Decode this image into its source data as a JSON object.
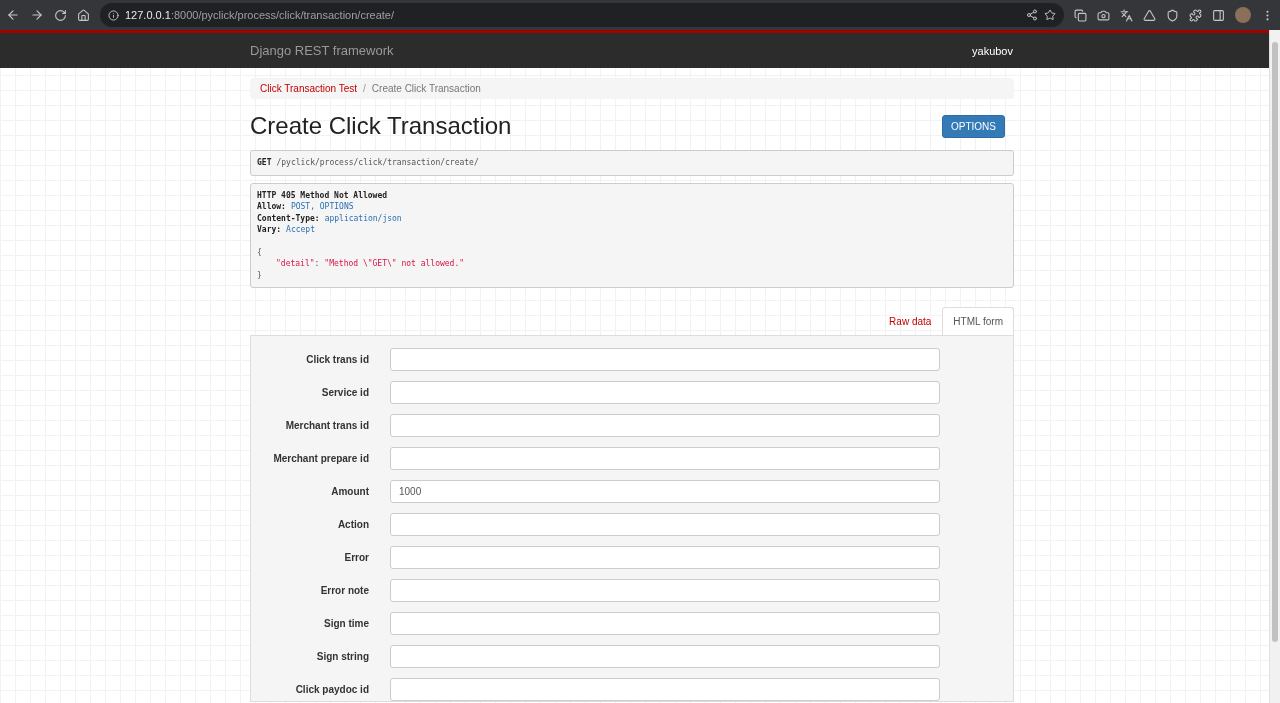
{
  "browser": {
    "url_host": "127.0.0.1",
    "url_rest": ":8000/pyclick/process/click/transaction/create/"
  },
  "navbar": {
    "brand": "Django REST framework",
    "user": "yakubov"
  },
  "breadcrumb_separator": "/",
  "breadcrumb": [
    {
      "label": "Click Transaction Test",
      "active": false
    },
    {
      "label": "Create Click Transaction",
      "active": true
    }
  ],
  "title": "Create Click Transaction",
  "options_button": "OPTIONS",
  "request": {
    "method": "GET",
    "path": "/pyclick/process/click/transaction/create/"
  },
  "response": {
    "status": "HTTP 405 Method Not Allowed",
    "headers": [
      {
        "name": "Allow:",
        "value": "POST, OPTIONS"
      },
      {
        "name": "Content-Type:",
        "value": "application/json"
      },
      {
        "name": "Vary:",
        "value": "Accept"
      }
    ],
    "open_brace": "{",
    "key": "\"detail\"",
    "colon": ":",
    "value": "\"Method \\\"GET\\\" not allowed.\"",
    "close_brace": "}"
  },
  "tabs": [
    {
      "label": "Raw data",
      "selected": false
    },
    {
      "label": "HTML form",
      "selected": true
    }
  ],
  "fields": [
    {
      "label": "Click trans id"
    },
    {
      "label": "Service id"
    },
    {
      "label": "Merchant trans id"
    },
    {
      "label": "Merchant prepare id"
    },
    {
      "label": "Amount",
      "value": "1000"
    },
    {
      "label": "Action"
    },
    {
      "label": "Error"
    },
    {
      "label": "Error note"
    },
    {
      "label": "Sign time"
    },
    {
      "label": "Sign string"
    },
    {
      "label": "Click paydoc id"
    }
  ]
}
